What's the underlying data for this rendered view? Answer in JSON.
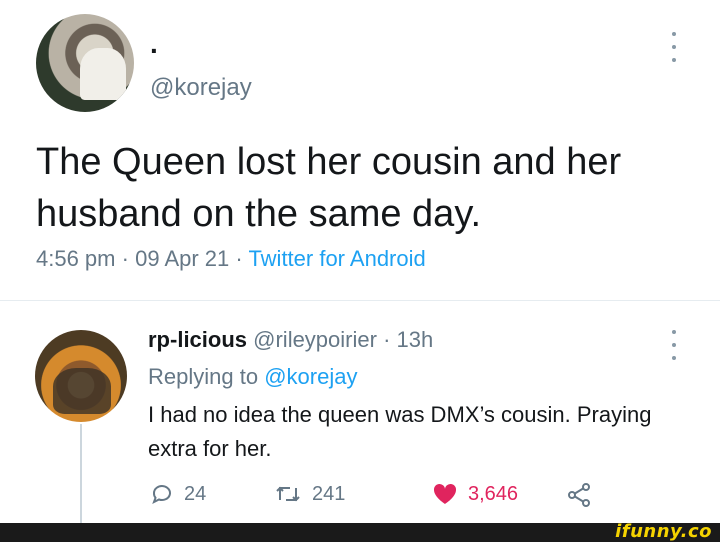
{
  "main_tweet": {
    "display_name": ".",
    "handle": "@korejay",
    "text": "The Queen lost her cousin and her husband on the same day.",
    "time": "4:56 pm",
    "date": "09 Apr 21",
    "separator": "·",
    "source": "Twitter for Android"
  },
  "reply": {
    "name": "rp-licious",
    "handle": "@rileypoirier",
    "age": "13h",
    "replying_label": "Replying to",
    "replying_to": "@korejay",
    "text": "I had no idea the queen was DMX’s cousin. Praying extra for her.",
    "actions": {
      "replies": "24",
      "retweets": "241",
      "likes": "3,646"
    }
  },
  "watermark": "ifunny.co",
  "colors": {
    "link": "#1da1f2",
    "muted": "#657786",
    "like": "#e0245e",
    "watermark": "#f5d300"
  },
  "icons": [
    "more-icon",
    "reply-icon",
    "retweet-icon",
    "heart-icon",
    "share-icon"
  ]
}
